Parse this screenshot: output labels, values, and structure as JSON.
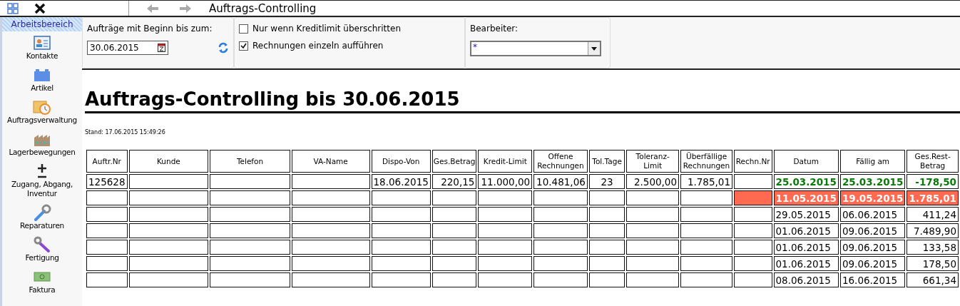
{
  "window": {
    "title": "Auftrags-Controlling"
  },
  "sidebar": {
    "header": {
      "label": "Arbeitsbereich",
      "selected": true
    },
    "items": [
      {
        "label": "Kontakte",
        "kind": "contacts"
      },
      {
        "label": "Artikel",
        "kind": "article"
      },
      {
        "label": "Auftragsverwaltung",
        "kind": "orders"
      },
      {
        "label": "Lagerbewegungen",
        "kind": "warehouse"
      },
      {
        "label": "Zugang, Abgang, Inventur",
        "kind": "plusminus"
      },
      {
        "label": "Reparaturen",
        "kind": "wrench"
      },
      {
        "label": "Fertigung",
        "kind": "tool"
      },
      {
        "label": "Faktura",
        "kind": "money"
      }
    ]
  },
  "filters": {
    "date_label": "Aufträge mit Beginn bis zum:",
    "date_value": "30.06.2015",
    "options": [
      {
        "label": "Nur wenn Kreditlimit überschritten",
        "checked": false
      },
      {
        "label": "Rechnungen einzeln aufführen",
        "checked": true
      }
    ],
    "editor_label": "Bearbeiter:",
    "editor_value": "*"
  },
  "report": {
    "title": "Auftrags-Controlling bis 30.06.2015",
    "stand": "Stand: 17.06.2015 15:49:26",
    "columns": [
      "Auftr.Nr",
      "Kunde",
      "Telefon",
      "VA-Name",
      "Dispo-Von",
      "Ges.Betrag",
      "Kredit-Limit",
      "Offene Rechnungen",
      "Tol.Tage",
      "Toleranz-Limit",
      "Überfällige Rechnungen",
      "Rechn.Nr",
      "Datum",
      "Fällig am",
      "Ges.Rest-Betrag"
    ],
    "rows": [
      {
        "paid": true,
        "overdue": false,
        "cells": [
          "125628",
          "",
          "",
          "",
          "18.06.2015",
          "220,15",
          "11.000,00",
          "10.481,06",
          "23",
          "2.500,00",
          "1.785,01",
          "",
          "25.03.2015",
          "25.03.2015",
          "-178,50"
        ]
      },
      {
        "paid": false,
        "overdue": true,
        "cells": [
          "",
          "",
          "",
          "",
          "",
          "",
          "",
          "",
          "",
          "",
          "",
          "",
          "11.05.2015",
          "19.05.2015",
          "1.785,01"
        ]
      },
      {
        "paid": false,
        "overdue": false,
        "cells": [
          "",
          "",
          "",
          "",
          "",
          "",
          "",
          "",
          "",
          "",
          "",
          "",
          "29.05.2015",
          "06.06.2015",
          "411,24"
        ]
      },
      {
        "paid": false,
        "overdue": false,
        "cells": [
          "",
          "",
          "",
          "",
          "",
          "",
          "",
          "",
          "",
          "",
          "",
          "",
          "01.06.2015",
          "09.06.2015",
          "7.489,90"
        ]
      },
      {
        "paid": false,
        "overdue": false,
        "cells": [
          "",
          "",
          "",
          "",
          "",
          "",
          "",
          "",
          "",
          "",
          "",
          "",
          "01.06.2015",
          "09.06.2015",
          "133,58"
        ]
      },
      {
        "paid": false,
        "overdue": false,
        "cells": [
          "",
          "",
          "",
          "",
          "",
          "",
          "",
          "",
          "",
          "",
          "",
          "",
          "01.06.2015",
          "09.06.2015",
          "178,50"
        ]
      },
      {
        "paid": false,
        "overdue": false,
        "cells": [
          "",
          "",
          "",
          "",
          "",
          "",
          "",
          "",
          "",
          "",
          "",
          "",
          "08.06.2015",
          "16.06.2015",
          "661,34"
        ]
      }
    ]
  }
}
